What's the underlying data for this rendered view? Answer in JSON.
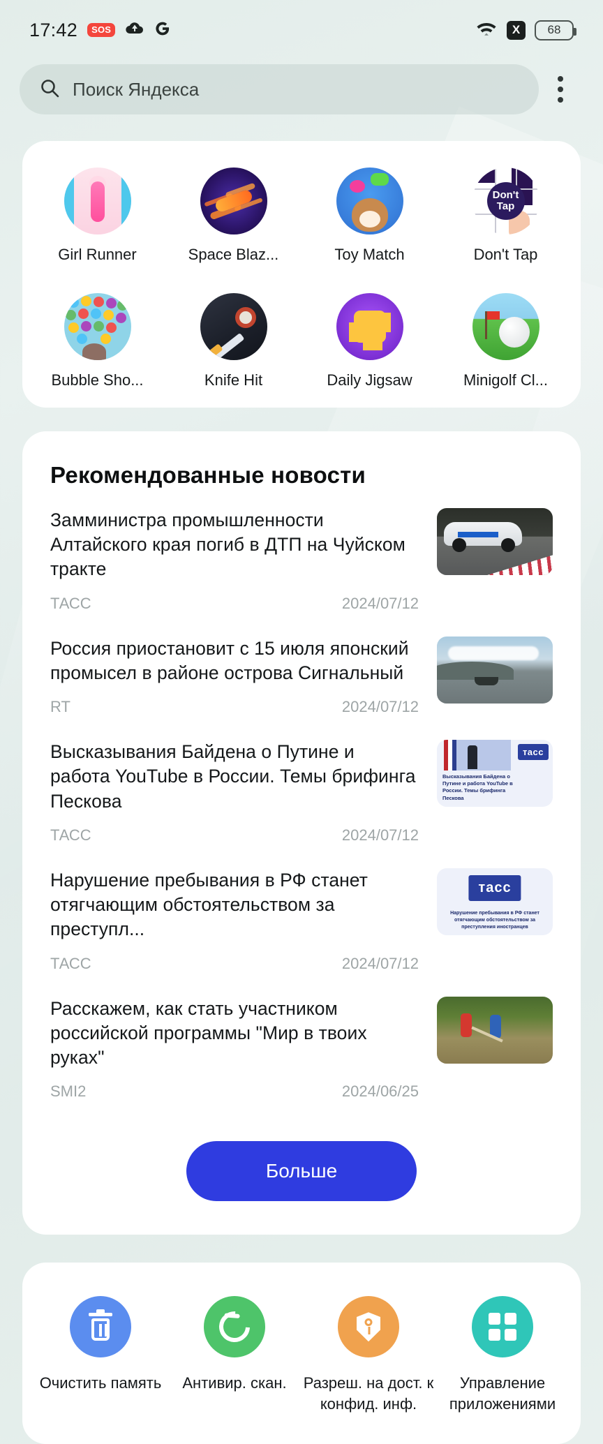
{
  "status_bar": {
    "time": "17:42",
    "sos_badge": "SOS",
    "cloud_icon": "cloud-icon",
    "google_icon": "G",
    "wifi_icon": "wifi-icon",
    "x_badge": "X",
    "battery_level": "68"
  },
  "search": {
    "placeholder": "Поиск Яндекса",
    "icon": "search-icon",
    "menu_icon": "kebab-menu-icon"
  },
  "games": {
    "items": [
      {
        "label": "Girl Runner",
        "icon": "girl-runner-icon"
      },
      {
        "label": "Space Blaz...",
        "icon": "space-blaze-icon"
      },
      {
        "label": "Toy Match",
        "icon": "toy-match-icon"
      },
      {
        "label": "Don't Tap",
        "icon": "dont-tap-icon",
        "badge_line1": "Don't",
        "badge_line2": "Tap"
      },
      {
        "label": "Bubble Sho...",
        "icon": "bubble-shooter-icon"
      },
      {
        "label": "Knife Hit",
        "icon": "knife-hit-icon"
      },
      {
        "label": "Daily Jigsaw",
        "icon": "daily-jigsaw-icon"
      },
      {
        "label": "Minigolf Cl...",
        "icon": "minigolf-club-icon"
      }
    ]
  },
  "news": {
    "title": "Рекомендованные новости",
    "items": [
      {
        "headline": "Замминистра промышленности Алтайского края погиб в ДТП на Чуйском тракте",
        "source": "ТАСС",
        "date": "2024/07/12",
        "thumb": "police-car-accident-thumbnail"
      },
      {
        "headline": "Россия приостановит с 15 июля японский промысел в районе острова Сигнальный",
        "source": "RT",
        "date": "2024/07/12",
        "thumb": "lake-boats-thumbnail"
      },
      {
        "headline": "Высказывания Байдена о Путине и работа YouTube в России. Темы брифинга Пескова",
        "source": "ТАСС",
        "date": "2024/07/12",
        "thumb": "tass-biden-card-thumbnail",
        "thumb_logo": "тасс",
        "thumb_caption": "Высказывания Байдена о Путине и работа YouTube в России. Темы брифинга Пескова"
      },
      {
        "headline": "Нарушение пребывания в РФ станет отягчающим обстоятельством за преступл...",
        "source": "ТАСС",
        "date": "2024/07/12",
        "thumb": "tass-logo-card-thumbnail",
        "thumb_logo": "тасс",
        "thumb_caption": "Нарушение пребывания в РФ станет отягчающим обстоятельством за преступления иностранцев"
      },
      {
        "headline": "Расскажем, как стать участником российской программы \"Мир в твоих руках\"",
        "source": "SMI2",
        "date": "2024/06/25",
        "thumb": "volunteers-field-thumbnail"
      }
    ],
    "more_button": "Больше",
    "more_button_color": "#2f3ce0"
  },
  "tools": {
    "items": [
      {
        "label": "Очистить память",
        "icon": "trash-icon",
        "color": "#5b8def"
      },
      {
        "label": "Антивир. скан.",
        "icon": "scan-shield-icon",
        "color": "#4ec46a"
      },
      {
        "label": "Разреш. на дост. к конфид. инф.",
        "icon": "shield-key-icon",
        "color": "#f0a24e"
      },
      {
        "label": "Управление приложениями",
        "icon": "app-grid-icon",
        "color": "#2fc6b8"
      }
    ]
  }
}
